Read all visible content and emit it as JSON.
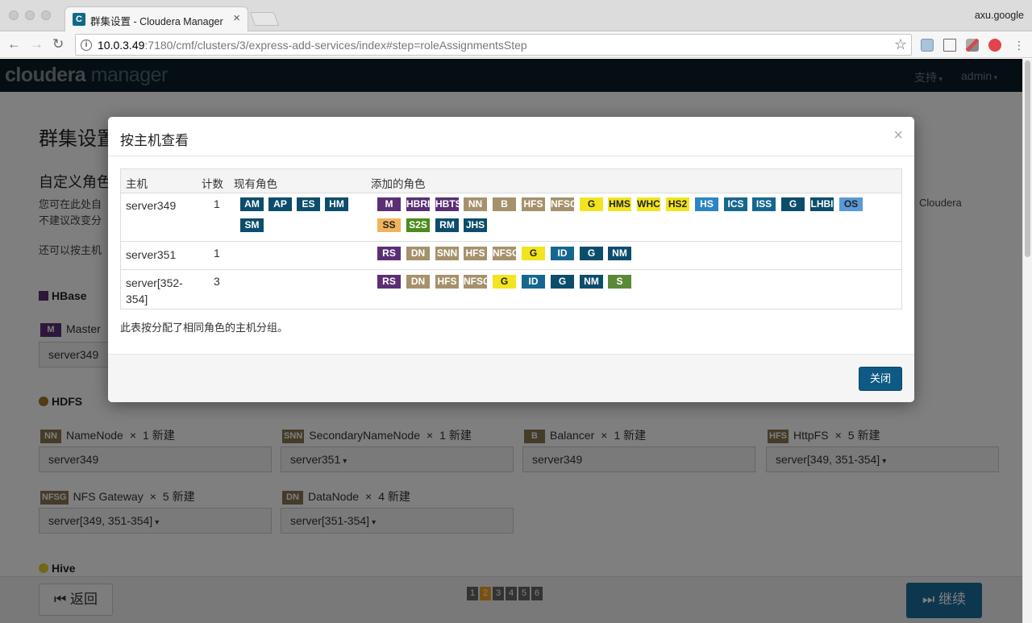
{
  "browser": {
    "tab_title": "群集设置 - Cloudera Manager",
    "tab_favicon": "C",
    "tab_close": "×",
    "profile": "axu.google",
    "url_host": "10.0.3.49",
    "url_rest": ":7180/cmf/clusters/3/express-add-services/index#step=roleAssignmentsStep",
    "info_glyph": "i",
    "back_glyph": "←",
    "forward_glyph": "→",
    "reload_glyph": "↻",
    "star_glyph": "☆"
  },
  "app": {
    "logo_main": "cloudera",
    "logo_sub": "manager",
    "menu_support": "支持",
    "menu_admin": "admin"
  },
  "page": {
    "title": "群集设置",
    "subtitle": "自定义角色",
    "desc_line1": "您可在此处自",
    "desc_line2": "不建议改变分",
    "desc_right": "Cloudera",
    "desc2": "还可以按主机",
    "hbase_label": "HBase",
    "hbase_master_badge": "M",
    "hbase_master_label": "Master",
    "hbase_master_value": "server349",
    "hdfs_label": "HDFS",
    "hive_label": "Hive",
    "roles": [
      {
        "badge": "NN",
        "color": "#8a7753",
        "name": "NameNode",
        "mult": "×",
        "count": "1 新建",
        "value": "server349",
        "dropdown": false
      },
      {
        "badge": "SNN",
        "color": "#8a7753",
        "name": "SecondaryNameNode",
        "mult": "×",
        "count": "1 新建",
        "value": "server351",
        "dropdown": true
      },
      {
        "badge": "B",
        "color": "#8a7753",
        "name": "Balancer",
        "mult": "×",
        "count": "1 新建",
        "value": "server349",
        "dropdown": false
      },
      {
        "badge": "HFS",
        "color": "#8a7753",
        "name": "HttpFS",
        "mult": "×",
        "count": "5 新建",
        "value": "server[349, 351-354]",
        "dropdown": true
      },
      {
        "badge": "NFSG",
        "color": "#8a7753",
        "name": "NFS Gateway",
        "mult": "×",
        "count": "5 新建",
        "value": "server[349, 351-354]",
        "dropdown": true
      },
      {
        "badge": "DN",
        "color": "#8a7753",
        "name": "DataNode",
        "mult": "×",
        "count": "4 新建",
        "value": "server[351-354]",
        "dropdown": true
      }
    ],
    "back_label": "返回",
    "continue_label": "继续",
    "steps": [
      "1",
      "2",
      "3",
      "4",
      "5",
      "6"
    ],
    "current_step": "2"
  },
  "modal": {
    "title": "按主机查看",
    "close_x": "×",
    "headers": {
      "host": "主机",
      "count": "计数",
      "existing": "现有角色",
      "added": "添加的角色"
    },
    "rows": [
      {
        "host": "server349",
        "count": "1",
        "existing": [
          {
            "t": "AM",
            "c": "#0c4d6b"
          },
          {
            "t": "AP",
            "c": "#0c4d6b"
          },
          {
            "t": "ES",
            "c": "#0c4d6b"
          },
          {
            "t": "HM",
            "c": "#0c4d6b"
          },
          {
            "t": "SM",
            "c": "#0c4d6b"
          }
        ],
        "added": [
          {
            "t": "M",
            "c": "#5a2f74"
          },
          {
            "t": "HBRI",
            "c": "#5a2f74"
          },
          {
            "t": "HBTS",
            "c": "#5a2f74"
          },
          {
            "t": "NN",
            "c": "#a5916b"
          },
          {
            "t": "B",
            "c": "#a5916b"
          },
          {
            "t": "HFS",
            "c": "#a5916b"
          },
          {
            "t": "NFSG",
            "c": "#a5916b"
          },
          {
            "t": "G",
            "c": "#f2e51f",
            "dark": true
          },
          {
            "t": "HMS",
            "c": "#f2e51f",
            "dark": true
          },
          {
            "t": "WHC",
            "c": "#f2e51f",
            "dark": true
          },
          {
            "t": "HS2",
            "c": "#f2e51f",
            "dark": true
          },
          {
            "t": "HS",
            "c": "#2b84c3"
          },
          {
            "t": "ICS",
            "c": "#16678e"
          },
          {
            "t": "ISS",
            "c": "#16678e"
          },
          {
            "t": "G",
            "c": "#0c4d6b"
          },
          {
            "t": "LHBI",
            "c": "#0c4d6b"
          },
          {
            "t": "OS",
            "c": "#5a9ad6",
            "dark": true
          },
          {
            "t": "SS",
            "c": "#f0b35d",
            "dark": true
          },
          {
            "t": "S2S",
            "c": "#4c8c1d"
          },
          {
            "t": "RM",
            "c": "#0c4d6b"
          },
          {
            "t": "JHS",
            "c": "#0c4d6b"
          }
        ]
      },
      {
        "host": "server351",
        "count": "1",
        "existing": [],
        "added": [
          {
            "t": "RS",
            "c": "#5a2f74"
          },
          {
            "t": "DN",
            "c": "#a5916b"
          },
          {
            "t": "SNN",
            "c": "#a5916b"
          },
          {
            "t": "HFS",
            "c": "#a5916b"
          },
          {
            "t": "NFSG",
            "c": "#a5916b"
          },
          {
            "t": "G",
            "c": "#f2e51f",
            "dark": true
          },
          {
            "t": "ID",
            "c": "#16678e"
          },
          {
            "t": "G",
            "c": "#0c4d6b"
          },
          {
            "t": "NM",
            "c": "#0c4d6b"
          }
        ]
      },
      {
        "host": "server[352-354]",
        "count": "3",
        "existing": [],
        "added": [
          {
            "t": "RS",
            "c": "#5a2f74"
          },
          {
            "t": "DN",
            "c": "#a5916b"
          },
          {
            "t": "HFS",
            "c": "#a5916b"
          },
          {
            "t": "NFSG",
            "c": "#a5916b"
          },
          {
            "t": "G",
            "c": "#f2e51f",
            "dark": true
          },
          {
            "t": "ID",
            "c": "#16678e"
          },
          {
            "t": "G",
            "c": "#0c4d6b"
          },
          {
            "t": "NM",
            "c": "#0c4d6b"
          },
          {
            "t": "S",
            "c": "#5a8a38"
          }
        ]
      }
    ],
    "note": "此表按分配了相同角色的主机分组。",
    "close_label": "关闭"
  }
}
